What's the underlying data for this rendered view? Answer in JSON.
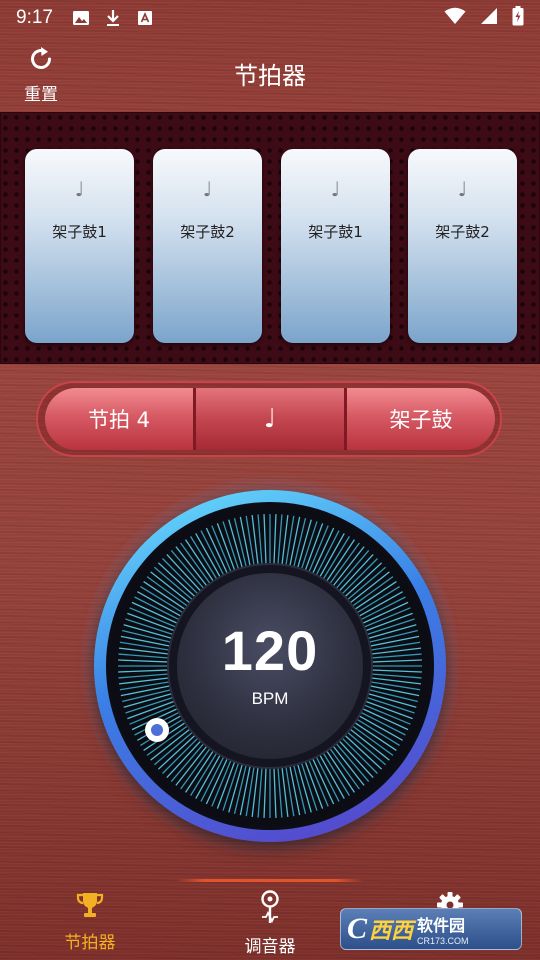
{
  "status_bar": {
    "time": "9:17",
    "left_icons": [
      "image-icon",
      "download-icon",
      "font-icon"
    ],
    "right_icons": [
      "wifi-icon",
      "signal-icon",
      "battery-icon"
    ]
  },
  "header": {
    "reset_label": "重置",
    "title": "节拍器"
  },
  "pads": [
    {
      "note": "♩",
      "label": "架子鼓1"
    },
    {
      "note": "♩",
      "label": "架子鼓2"
    },
    {
      "note": "♩",
      "label": "架子鼓1"
    },
    {
      "note": "♩",
      "label": "架子鼓2"
    }
  ],
  "segment": {
    "beat": "节拍 4",
    "note": "♩",
    "instrument": "架子鼓"
  },
  "dial": {
    "bpm": "120",
    "unit": "BPM"
  },
  "bottom_nav": {
    "items": [
      {
        "label": "节拍器",
        "icon": "trophy-icon",
        "active": true
      },
      {
        "label": "调音器",
        "icon": "tuner-pin-icon",
        "active": false
      },
      {
        "label": "设置",
        "icon": "gear-icon",
        "active": false
      }
    ]
  },
  "watermark": {
    "logo_letter": "C",
    "logo_chars": "西西",
    "main": "软件园",
    "sub": "CR173.COM"
  },
  "colors": {
    "accent_active": "#f2b022",
    "pad_panel_bg": "#3d0b15",
    "dial_ring": "#3a7fe6"
  }
}
